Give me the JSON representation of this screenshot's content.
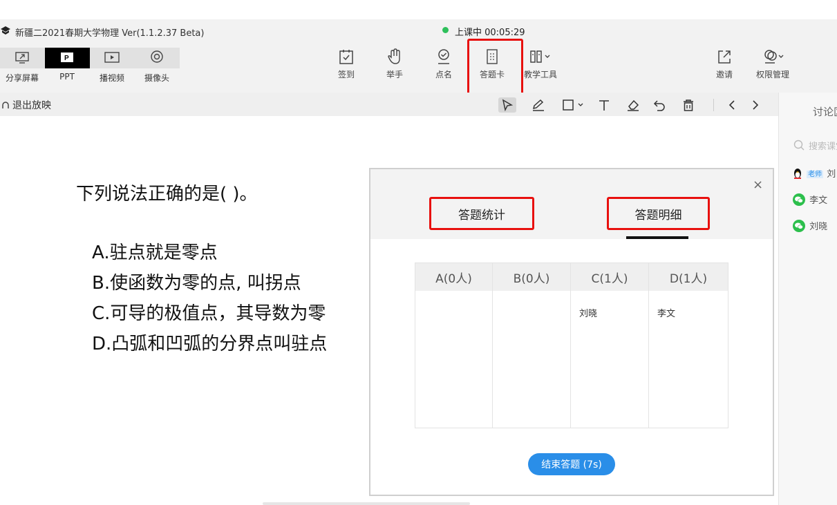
{
  "app": {
    "title": "新疆二2021春期大学物理 Ver(1.1.2.37 Beta)",
    "status": "上课中 00:05:29",
    "status_color": "#2ec05b"
  },
  "modes": [
    {
      "label": "分享屏幕",
      "icon": "share-screen-icon"
    },
    {
      "label": "PPT",
      "icon": "ppt-icon"
    },
    {
      "label": "播视频",
      "icon": "play-video-icon"
    },
    {
      "label": "摄像头",
      "icon": "camera-icon"
    }
  ],
  "tools": [
    {
      "label": "签到",
      "icon": "check-in-icon"
    },
    {
      "label": "举手",
      "icon": "raise-hand-icon"
    },
    {
      "label": "点名",
      "icon": "roll-call-icon"
    },
    {
      "label": "答题卡",
      "icon": "answer-card-icon"
    },
    {
      "label": "教学工具",
      "icon": "teaching-tools-icon"
    }
  ],
  "right_tools": [
    {
      "label": "邀请",
      "icon": "invite-icon"
    },
    {
      "label": "权限管理",
      "icon": "permission-icon"
    }
  ],
  "subbar": {
    "exit_label": "退出放映"
  },
  "sidepanel": {
    "tab": "讨论区",
    "search_placeholder": "搜索课堂成员",
    "teacher_badge": "老师",
    "members": [
      "刘",
      "李文",
      "刘晓"
    ]
  },
  "slide": {
    "question": "下列说法正确的是(     )。",
    "options": [
      "A.驻点就是零点",
      "B.使函数为零的点, 叫拐点",
      "C.可导的极值点，其导数为零",
      "D.凸弧和凹弧的分界点叫驻点"
    ]
  },
  "dialog": {
    "close": "×",
    "tabs": [
      "答题统计",
      "答题明细"
    ],
    "columns": [
      {
        "header": "A(0人)",
        "names": []
      },
      {
        "header": "B(0人)",
        "names": []
      },
      {
        "header": "C(1人)",
        "names": [
          "刘晓"
        ]
      },
      {
        "header": "D(1人)",
        "names": [
          "李文"
        ]
      }
    ],
    "end_button": "结束答题 (7s)"
  },
  "colors": {
    "highlight": "#e8100e",
    "accent": "#2a8ee8"
  }
}
